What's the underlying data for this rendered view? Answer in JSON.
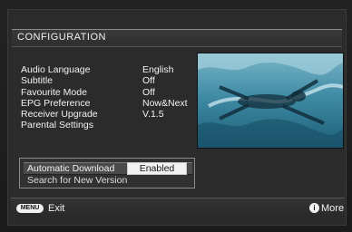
{
  "title": "CONFIGURATION",
  "menu": [
    {
      "label": "Audio Language",
      "value": "English"
    },
    {
      "label": "Subtitle",
      "value": "Off"
    },
    {
      "label": "Favourite Mode",
      "value": "Off"
    },
    {
      "label": "EPG Preference",
      "value": "Now&Next"
    },
    {
      "label": "Receiver Upgrade",
      "value": "V.1.5"
    },
    {
      "label": "Parental Settings",
      "value": ""
    }
  ],
  "download": {
    "label": "Automatic Download",
    "value": "Enabled",
    "search_label": "Search for New Version"
  },
  "footer": {
    "menu_badge": "MENU",
    "exit_label": "Exit",
    "info_badge": "i",
    "more_label": "More"
  },
  "preview": {
    "icon": "swimmer-video-preview"
  },
  "colors": {
    "background": "#2b2b2b",
    "highlight": "#f2f2f2",
    "preview": "#2d6f86"
  }
}
